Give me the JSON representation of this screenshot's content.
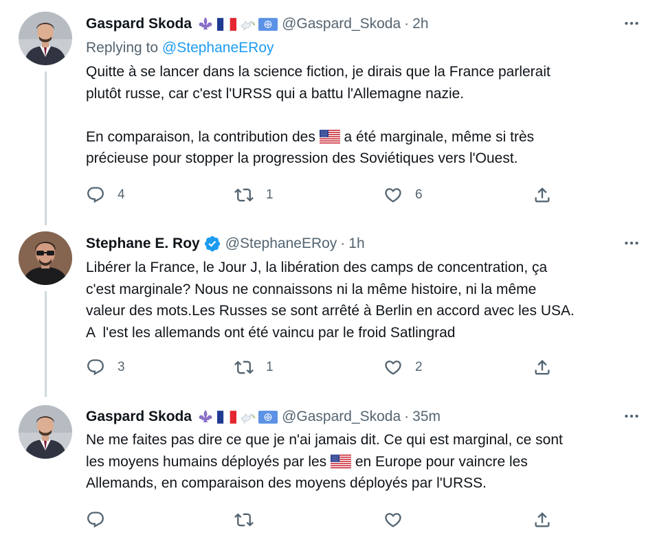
{
  "tweets": [
    {
      "display_name": "Gaspard Skoda",
      "handle": "@Gaspard_Skoda",
      "separator": "·",
      "time": "2h",
      "badges": [
        "fleur-de-lis-emoji",
        "france-flag-emoji",
        "dove-emoji",
        "united-nations-flag-emoji"
      ],
      "replying_label": "Replying to ",
      "replying_mention": "@StephaneERoy",
      "line1": "Quitte à se lancer dans la science fiction, je dirais que la France parlerait",
      "line2": "plutôt russe, car c'est l'URSS qui a battu l'Allemagne nazie.",
      "line3_before": "En comparaison, la contribution des ",
      "line3_after": " a été marginale, même si très",
      "line4": "précieuse pour stopper la progression des Soviétiques vers l'Ouest.",
      "replies": "4",
      "retweets": "1",
      "likes": "6"
    },
    {
      "display_name": "Stephane E. Roy",
      "handle": "@StephaneERoy",
      "separator": "·",
      "time": "1h",
      "verified": true,
      "line1": "Libérer la France, le Jour J, la libération des camps de concentration, ça",
      "line2": "c'est marginale? Nous ne connaissons ni la même histoire, ni la même",
      "line3": "valeur des mots.Les Russes se sont arrêté à Berlin en accord avec les USA.",
      "line4": "A  l'est les allemands ont été vaincu par le froid Satlingrad",
      "replies": "3",
      "retweets": "1",
      "likes": "2"
    },
    {
      "display_name": "Gaspard Skoda",
      "handle": "@Gaspard_Skoda",
      "separator": "·",
      "time": "35m",
      "badges": [
        "fleur-de-lis-emoji",
        "france-flag-emoji",
        "dove-emoji",
        "united-nations-flag-emoji"
      ],
      "line1": "Ne me faites pas dire ce que je n'ai jamais dit. Ce qui est marginal, ce sont",
      "line2_before": "les moyens humains déployés par les ",
      "line2_after": " en Europe pour vaincre les",
      "line3": "Allemands, en comparaison des moyens déployés par l'URSS."
    }
  ],
  "colors": {
    "text": "#0f1419",
    "secondary": "#536471",
    "link": "#1d9bf0",
    "thread_line": "#cfd9de"
  },
  "icons": [
    "reply-icon",
    "retweet-icon",
    "like-icon",
    "share-icon",
    "more-icon",
    "verified-badge-icon",
    "us-flag-emoji"
  ]
}
